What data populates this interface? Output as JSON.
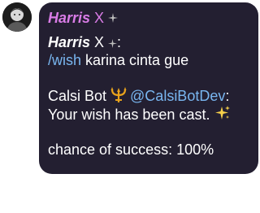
{
  "avatar": {
    "icon": "user-avatar-dark"
  },
  "message": {
    "sender_name": "Harris",
    "sender_suffix": "X",
    "quote": {
      "name": "Harris",
      "suffix": "X",
      "colon": ":"
    },
    "command": "/wish",
    "command_args": " karina cinta gue",
    "bot_name": "Calsi Bot",
    "bot_mention": "@CalsiBotDev",
    "bot_colon": ":",
    "result": "Your wish has been cast.",
    "chance": "chance of success: 100%"
  },
  "colors": {
    "bubble": "#231f31",
    "sender": "#d97ce6",
    "link": "#79b6f0",
    "text": "#ffffff"
  },
  "icons": {
    "sender_emoji": "sparkle-small-icon",
    "trident": "trident-icon",
    "sparkles": "sparkles-icon"
  }
}
